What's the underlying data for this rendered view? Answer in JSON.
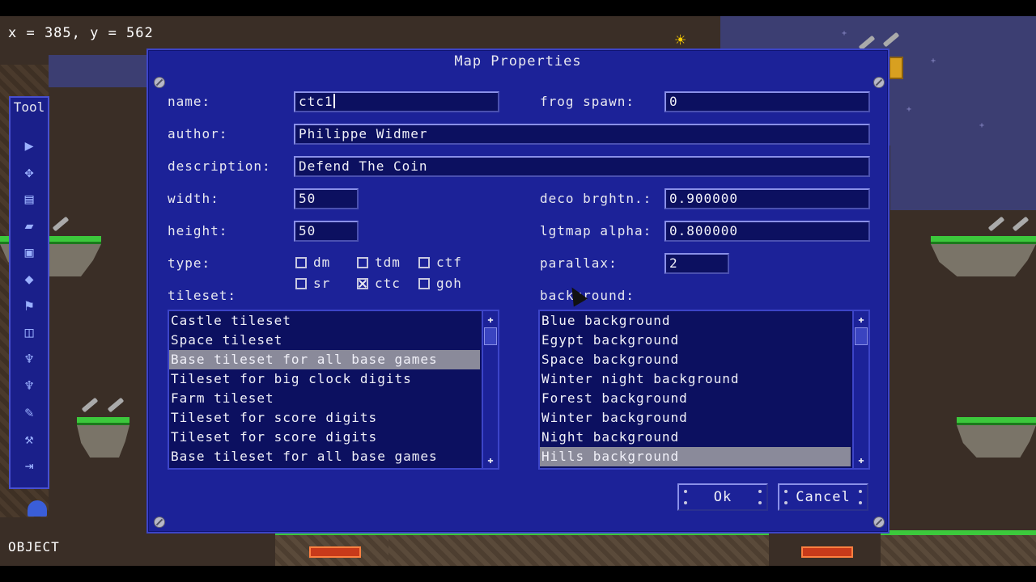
{
  "hud": {
    "coords": "x = 385, y = 562",
    "mode": "OBJECT"
  },
  "tool_palette": {
    "title": "Tool",
    "tools": [
      {
        "icon": "pointer-icon",
        "glyph": "▶"
      },
      {
        "icon": "move-icon",
        "glyph": "✥"
      },
      {
        "icon": "new-file-icon",
        "glyph": "▤"
      },
      {
        "icon": "open-folder-icon",
        "glyph": "▰"
      },
      {
        "icon": "save-icon",
        "glyph": "▣"
      },
      {
        "icon": "tile-icon",
        "glyph": "◆"
      },
      {
        "icon": "flag-icon",
        "glyph": "⚑"
      },
      {
        "icon": "layers-icon",
        "glyph": "◫"
      },
      {
        "icon": "decoration-icon",
        "glyph": "♆"
      },
      {
        "icon": "decoration-2-icon",
        "glyph": "♆"
      },
      {
        "icon": "broom-icon",
        "glyph": "✎"
      },
      {
        "icon": "wrench-icon",
        "glyph": "⚒"
      },
      {
        "icon": "exit-icon",
        "glyph": "⇥"
      }
    ]
  },
  "dialog": {
    "title": "Map Properties",
    "labels": {
      "name": "name:",
      "author": "author:",
      "description": "description:",
      "width": "width:",
      "height": "height:",
      "type": "type:",
      "tileset": "tileset:",
      "frog_spawn": "frog spawn:",
      "deco_brightness": "deco brghtn.:",
      "lightmap_alpha": "lgtmap alpha:",
      "parallax": "parallax:",
      "background": "background:"
    },
    "values": {
      "name": "ctc1",
      "author": "Philippe Widmer",
      "description": "Defend The Coin",
      "width": "50",
      "height": "50",
      "frog_spawn": "0",
      "deco_brightness": "0.900000",
      "lightmap_alpha": "0.800000",
      "parallax": "2"
    },
    "types": [
      {
        "label": "dm",
        "checked": false
      },
      {
        "label": "tdm",
        "checked": false
      },
      {
        "label": "ctf",
        "checked": false
      },
      {
        "label": "sr",
        "checked": false
      },
      {
        "label": "ctc",
        "checked": true
      },
      {
        "label": "goh",
        "checked": false
      }
    ],
    "tilesets": [
      "Castle tileset",
      "Space tileset",
      "Base tileset for all base games",
      "Tileset for big clock digits",
      "Farm tileset",
      "Tileset for score digits",
      "Tileset for score digits",
      "Base tileset for all base games"
    ],
    "tileset_selected_index": 2,
    "backgrounds": [
      "Blue background",
      "Egypt background",
      "Space background",
      "Winter night background",
      "Forest background",
      "Winter background",
      "Night background",
      "Hills background"
    ],
    "background_selected_index": 7,
    "buttons": {
      "ok": "Ok",
      "cancel": "Cancel"
    }
  },
  "colors": {
    "dialog_bg": "#1c2298",
    "field_bg": "#0c1060",
    "selection": "#8a8a9a",
    "grass": "#3cc83c"
  }
}
